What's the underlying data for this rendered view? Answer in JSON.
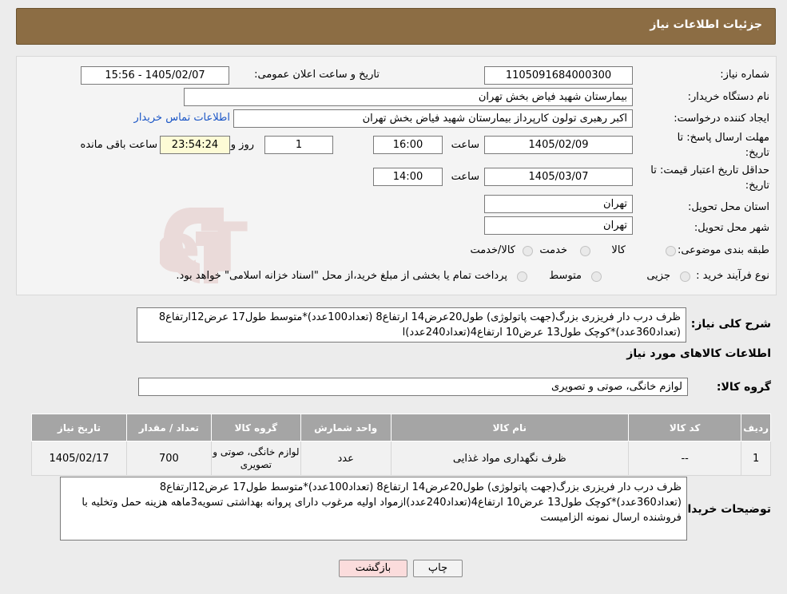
{
  "header": {
    "title": "جزئیات اطلاعات نیاز"
  },
  "fields": {
    "need_number_label": "شماره نیاز:",
    "need_number": "1105091684000300",
    "announce_label": "تاریخ و ساعت اعلان عمومی:",
    "announce_value": "1405/02/07 - 15:56",
    "buyer_org_label": "نام دستگاه خریدار:",
    "buyer_org": "بیمارستان شهید فیاض بخش تهران",
    "requester_label": "ایجاد کننده درخواست:",
    "requester": "اکبر رهبری تولون کارپرداز بیمارستان شهید فیاض بخش تهران",
    "contact_link": "اطلاعات تماس خریدار",
    "deadline_label_1": "مهلت ارسال پاسخ: تا",
    "deadline_label_2": "تاریخ:",
    "deadline_date": "1405/02/09",
    "time_label": "ساعت",
    "deadline_time": "16:00",
    "days_value": "1",
    "days_label": "روز و",
    "remaining_time": "23:54:24",
    "remaining_label": "ساعت باقی مانده",
    "validity_label_1": "حداقل تاریخ اعتبار قیمت: تا",
    "validity_label_2": "تاریخ:",
    "validity_date": "1405/03/07",
    "validity_time_label": "ساعت",
    "validity_time": "14:00",
    "province_label": "استان محل تحویل:",
    "province": "تهران",
    "city_label": "شهر محل تحویل:",
    "city": "تهران",
    "category_label": "طبقه بندی موضوعی:",
    "category_options": [
      "کالا",
      "خدمت",
      "کالا/خدمت"
    ],
    "process_label": "نوع فرآیند خرید :",
    "process_options": [
      "جزیی",
      "متوسط"
    ],
    "process_note": "پرداخت تمام یا بخشی از مبلغ خرید،از محل \"اسناد خزانه اسلامی\" خواهد بود."
  },
  "summary": {
    "label": "شرح کلی نیاز:",
    "text": "ظرف درب دار فریزری بزرگ(جهت پاتولوژی) طول20عرض14 ارتفاع8 (تعداد100عدد)*متوسط طول17 عرض12ارتفاع8 (تعداد360عدد)*کوچک طول13 عرض10 ارتفاع4(تعداد240عدد)ا"
  },
  "goods": {
    "section_title": "اطلاعات کالاهای مورد نیاز",
    "group_label": "گروه کالا:",
    "group_value": "لوازم خانگی، صوتی و تصویری"
  },
  "table": {
    "headers": [
      "ردیف",
      "کد کالا",
      "نام کالا",
      "واحد شمارش",
      "گروه کالا",
      "تعداد / مقدار",
      "تاریخ نیاز"
    ],
    "rows": [
      [
        "1",
        "--",
        "ظرف نگهداری مواد غذایی",
        "عدد",
        "لوازم خانگی، صوتی و تصویری",
        "700",
        "1405/02/17"
      ]
    ]
  },
  "buyer_notes": {
    "label": "توضیحات خریدار:",
    "text": "ظرف درب دار فریزری بزرگ(جهت پاتولوژی) طول20عرض14 ارتفاع8 (تعداد100عدد)*متوسط طول17 عرض12ارتفاع8 (تعداد360عدد)*کوچک طول13 عرض10 ارتفاع4(تعداد240عدد)ازمواد اولیه مرغوب دارای پروانه بهداشتی تسویه3ماهه هزینه حمل وتخلیه با فروشنده ارسال نمونه الزامیست"
  },
  "buttons": {
    "print": "چاپ",
    "back": "بازگشت"
  },
  "watermark": {
    "text": "AriaTender.neT"
  },
  "colors": {
    "header_bg": "#8c6d44",
    "table_header_bg": "#a5a5a5",
    "link": "#1b56c6",
    "back_button_bg": "#fbdcdc"
  }
}
